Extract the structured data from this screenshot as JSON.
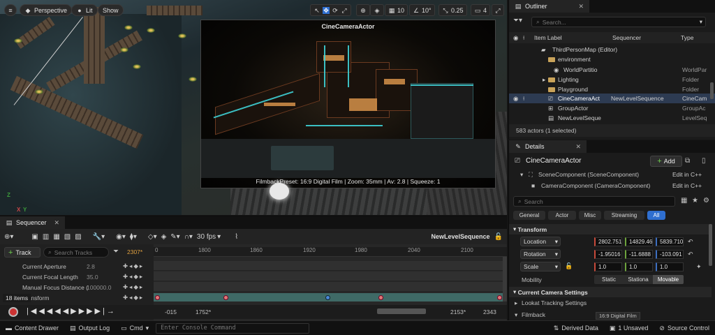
{
  "viewport": {
    "perspective_label": "Perspective",
    "lit_label": "Lit",
    "show_label": "Show",
    "grid_snap": "10",
    "angle_snap": "10°",
    "scale_snap": "0.25",
    "camera_speed": "4",
    "camera_title": "CineCameraActor",
    "camera_info": "FilmbackPreset: 16:9 Digital Film | Zoom: 35mm | Av: 2.8 | Squeeze: 1",
    "axis_x": "X",
    "axis_y": "Y",
    "axis_z": "Z"
  },
  "sequencer": {
    "tab_title": "Sequencer",
    "fps": "30 fps",
    "sequence_name": "NewLevelSequence",
    "track_label": "Track",
    "search_placeholder": "Search Tracks",
    "current_frame": "2307*",
    "items_count": "18 items",
    "tracks": [
      {
        "name": "Current Aperture",
        "value": "2.8"
      },
      {
        "name": "Current Focal Length",
        "value": "35.0"
      },
      {
        "name": "Manual Focus Distance (",
        "value": "100000.0"
      },
      {
        "name": "Transform",
        "value": ""
      }
    ],
    "ruler_ticks": [
      "1800",
      "1860",
      "1920",
      "1980",
      "2040",
      "2100"
    ],
    "ruler_start": "0",
    "range_start_left": "-015",
    "range_start": "1752*",
    "range_end": "2153*",
    "range_end_right": "2343"
  },
  "outliner": {
    "tab_title": "Outliner",
    "search_placeholder": "Search...",
    "col_label": "Item Label",
    "col_sequencer": "Sequencer",
    "col_type": "Type",
    "rows": [
      {
        "label": "ThirdPersonMap (Editor)",
        "seq": "",
        "type": ""
      },
      {
        "label": "environment",
        "seq": "",
        "type": ""
      },
      {
        "label": "WorldPartitio",
        "seq": "",
        "type": "WorldPar"
      },
      {
        "label": "Lighting",
        "seq": "",
        "type": "Folder"
      },
      {
        "label": "Playground",
        "seq": "",
        "type": "Folder"
      },
      {
        "label": "CineCameraAct",
        "seq": "NewLevelSequence",
        "type": "CineCam"
      },
      {
        "label": "GroupActor",
        "seq": "",
        "type": "GroupAc"
      },
      {
        "label": "NewLevelSeque",
        "seq": "",
        "type": "LevelSeq"
      }
    ],
    "count": "583 actors (1 selected)"
  },
  "details": {
    "tab_title": "Details",
    "actor_name": "CineCameraActor",
    "add_label": "Add",
    "components": [
      {
        "name": "SceneComponent (SceneComponent)",
        "link": "Edit in C++"
      },
      {
        "name": "CameraComponent (CameraComponent)",
        "link": "Edit in C++"
      }
    ],
    "search_placeholder": "Search",
    "filters": [
      "General",
      "Actor",
      "Misc",
      "Streaming",
      "All"
    ],
    "transform_header": "Transform",
    "location_label": "Location",
    "location": [
      "2802.751",
      "14829.46",
      "5839.710"
    ],
    "rotation_label": "Rotation",
    "rotation": [
      "-1.95016",
      "-11.6888",
      "-103.091"
    ],
    "scale_label": "Scale",
    "scale": [
      "1.0",
      "1.0",
      "1.0"
    ],
    "mobility_label": "Mobility",
    "mobility_options": [
      "Static",
      "Stationa",
      "Movable"
    ],
    "camera_settings_header": "Current Camera Settings",
    "lookat_label": "Lookat Tracking Settings",
    "filmback_label": "Filmback",
    "filmback_value": "16:9 Digital Film"
  },
  "statusbar": {
    "content_drawer": "Content Drawer",
    "output_log": "Output Log",
    "cmd": "Cmd",
    "console_placeholder": "Enter Console Command",
    "derived_data": "Derived Data",
    "unsaved": "1 Unsaved",
    "source_control": "Source Control"
  }
}
